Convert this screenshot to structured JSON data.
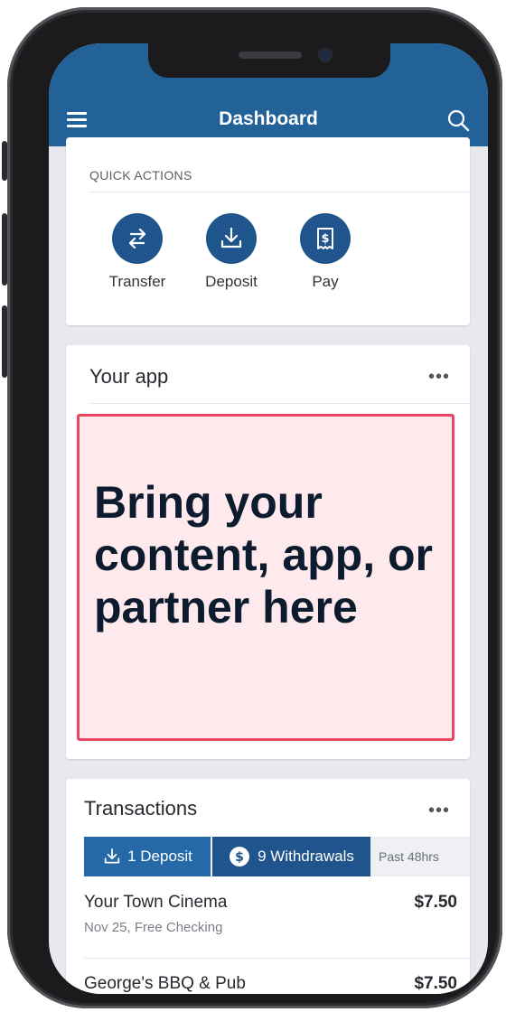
{
  "header": {
    "title": "Dashboard"
  },
  "quick_actions": {
    "label": "QUICK ACTIONS",
    "items": [
      {
        "label": "Transfer",
        "icon": "transfer-icon"
      },
      {
        "label": "Deposit",
        "icon": "deposit-icon"
      },
      {
        "label": "Pay",
        "icon": "bill-pay-icon"
      }
    ]
  },
  "your_app": {
    "title": "Your app",
    "more": "•••",
    "promo_text": "Bring your content, app, or partner here"
  },
  "transactions": {
    "title": "Transactions",
    "more": "•••",
    "tabs": {
      "deposit": "1 Deposit",
      "withdrawals": "9 Withdrawals",
      "period": "Past 48hrs"
    },
    "rows": [
      {
        "name": "Your Town Cinema",
        "sub": "Nov 25, Free Checking",
        "amount": "$7.50"
      },
      {
        "name": "George's BBQ & Pub",
        "amount": "$7.50"
      }
    ]
  },
  "colors": {
    "header": "#236299",
    "accent": "#1f558c",
    "promo_border": "#ea4460",
    "promo_bg": "#feeaed"
  }
}
